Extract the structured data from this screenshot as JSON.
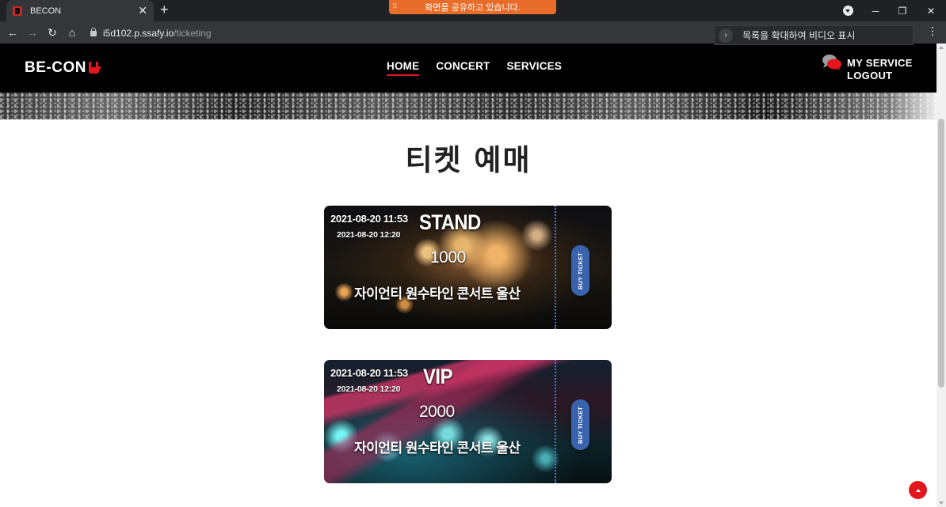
{
  "browser": {
    "tab_title": "BECON",
    "url_host": "i5d102.p.ssafy.io",
    "url_path": "/ticketing",
    "share_banner": "화면을 공유하고 있습니다.",
    "tooltip": "목록을 확대하여 비디오 표시"
  },
  "site": {
    "logo": "BE-CON",
    "nav": [
      "HOME",
      "CONCERT",
      "SERVICES"
    ],
    "active_nav": "HOME",
    "user_links": {
      "my_service": "MY SERVICE",
      "logout": "LOGOUT"
    },
    "page_title": "티켓 예매",
    "accent_color": "#e3161d",
    "buy_color": "#3a63ad"
  },
  "tickets": [
    {
      "date_main": "2021-08-20 11:53",
      "date_sub": "2021-08-20 12:20",
      "type": "STAND",
      "price": "1000",
      "concert_name": "자이언티 원수타인 콘서트 울산",
      "buy_label": "BUY TICKET"
    },
    {
      "date_main": "2021-08-20 11:53",
      "date_sub": "2021-08-20 12:20",
      "type": "VIP",
      "price": "2000",
      "concert_name": "자이언티 원수타인 콘서트 울산",
      "buy_label": "BUY TICKET"
    }
  ],
  "icons": {
    "tab_close": "close-icon",
    "new_tab": "plus-icon",
    "back": "arrow-left-icon",
    "forward": "arrow-right-icon",
    "reload": "reload-icon",
    "home": "home-icon",
    "lock": "lock-icon",
    "chat": "chat-icon",
    "scroll_top": "chevron-up-icon"
  }
}
